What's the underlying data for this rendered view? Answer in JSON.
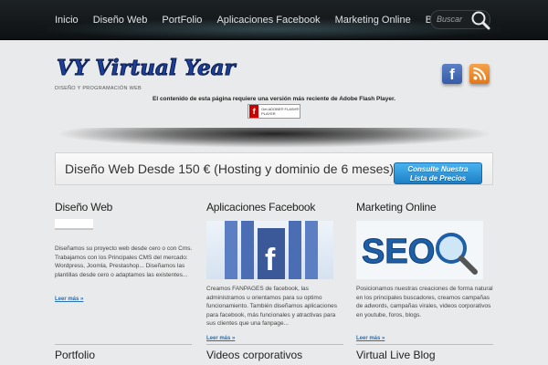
{
  "nav": {
    "items": [
      "Inicio",
      "Diseño Web",
      "PortFolio",
      "Aplicaciones Facebook",
      "Marketing Online",
      "Blog"
    ],
    "search_placeholder": "Buscar"
  },
  "header": {
    "logo_text": "VY Virtual Year",
    "tagline": "DISEÑO Y PROGRAMACIÓN WEB",
    "flash_message": "El contenido de esta página requiere una versión más reciente de Adobe Flash Player.",
    "flash_button": "Get ADOBE® FLASH® PLAYER"
  },
  "banner": {
    "text": "Diseño Web Desde 150 € (Hosting y dominio de 6 meses)",
    "button_line1": "Consulte Nuestra",
    "button_line2": "Lista de Precios"
  },
  "columns": [
    {
      "title": "Diseño Web",
      "text": "Diseñamos su proyecto web desde cero o con Cms. Trabajamos con los Principales CMS del mercado: Wordpress, Joomla, Prestashop... Diseñamos las plantillas desde cero o adaptamos las existentes...",
      "more": "Leer más »"
    },
    {
      "title": "Aplicaciones Facebook",
      "text": "Creamos FANPAGES de facebook, las administramos u orientamos para su optimo funcionamiento. También diseñamos aplicaciones para facebook, más funcionales y atractivas para sus clientes que una fanpage...",
      "more": "Leer más »"
    },
    {
      "title": "Marketing Online",
      "text": "Posicionamos nuestras creaciones de forma natural en los principales buscadores, creamos campañas de adwords, campañas virales, videos corporativos en youtube, foros, blogs.",
      "more": "Leer más »"
    }
  ],
  "bottom_titles": [
    "Portfolio",
    "Videos corporativos",
    "Virtual Live Blog"
  ],
  "images": {
    "seo_text": "SEO",
    "fb_letter": "f"
  },
  "colors": {
    "nav_bg": "#111517",
    "link": "#2a6fb0",
    "button_blue": "#2a8fd8",
    "facebook": "#3b5998",
    "rss": "#f08a24"
  }
}
